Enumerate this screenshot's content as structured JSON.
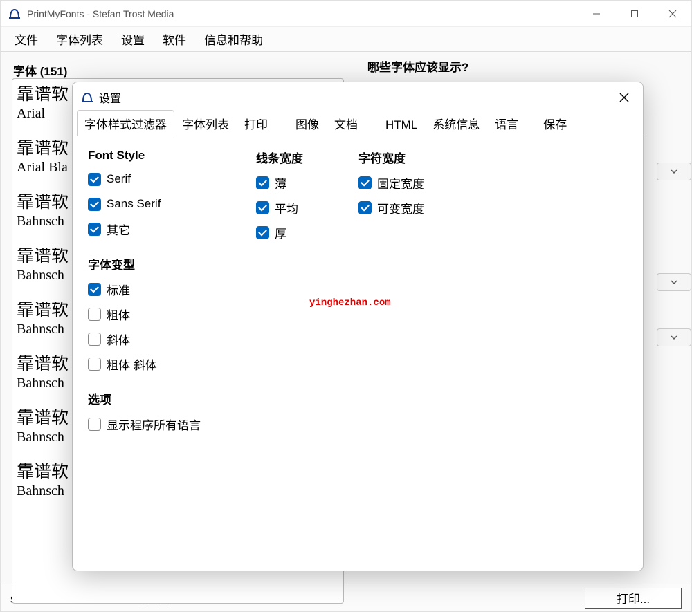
{
  "window": {
    "title": "PrintMyFonts - Stefan Trost Media"
  },
  "menu": {
    "file": "文件",
    "fontlist": "字体列表",
    "settings": "设置",
    "software": "软件",
    "help": "信息和帮助"
  },
  "main": {
    "fonts_header": "字体 (151)",
    "right_header": "哪些字体应该显示?",
    "sample_text": "靠谱软",
    "fonts": [
      {
        "name": "Arial"
      },
      {
        "name": "Arial Bla"
      },
      {
        "name": "Bahnsch"
      },
      {
        "name": "Bahnsch"
      },
      {
        "name": "Bahnsch"
      },
      {
        "name": "Bahnsch"
      },
      {
        "name": "Bahnsch"
      },
      {
        "name": "Bahnsch"
      }
    ]
  },
  "status": {
    "text": "sttmedia.com/donate - 谢谢您",
    "print": "打印..."
  },
  "dialog": {
    "title": "设置",
    "tabs": {
      "filter": "字体样式过滤器",
      "list": "字体列表",
      "print": "打印",
      "image": "图像",
      "doc": "文档",
      "html": "HTML",
      "sysinfo": "系统信息",
      "lang": "语言",
      "save": "保存"
    },
    "col1_style_title": "Font Style",
    "col1_style": {
      "serif": "Serif",
      "sans": "Sans Serif",
      "other": "其它"
    },
    "col1_variant_title": "字体变型",
    "col1_variant": {
      "standard": "标准",
      "bold": "粗体",
      "italic": "斜体",
      "bolditalic": "粗体 斜体"
    },
    "col1_options_title": "选项",
    "col1_options": {
      "showall": "显示程序所有语言"
    },
    "col2_title": "线条宽度",
    "col2": {
      "thin": "薄",
      "avg": "平均",
      "thick": "厚"
    },
    "col3_title": "字符宽度",
    "col3": {
      "fixed": "固定宽度",
      "var": "可变宽度"
    }
  },
  "watermark": "yinghezhan.com"
}
